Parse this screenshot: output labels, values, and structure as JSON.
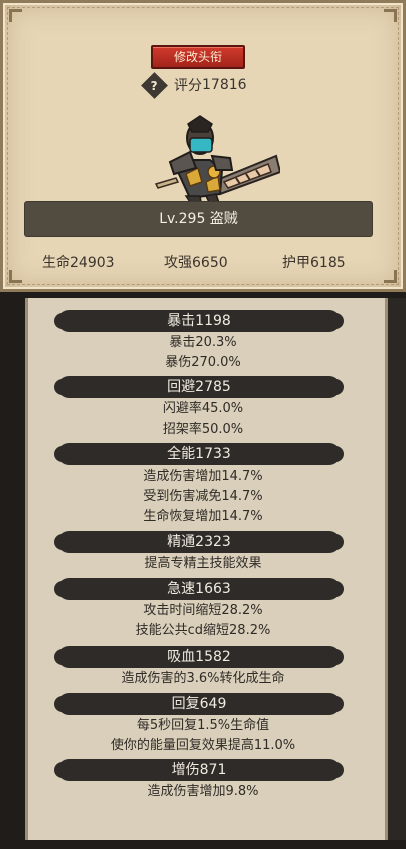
{
  "header": {
    "rename_button": "修改头衔",
    "score_label": "评分",
    "score_value": "17816",
    "name": "Lv.295 盗贼"
  },
  "base_stats": {
    "hp": "生命24903",
    "attack": "攻强6650",
    "armor": "护甲6185"
  },
  "stats": {
    "crit": {
      "title": "暴击1198",
      "lines": [
        "暴击20.3%",
        "暴伤270.0%"
      ]
    },
    "dodge": {
      "title": "回避2785",
      "lines": [
        "闪避率45.0%",
        "招架率50.0%"
      ]
    },
    "versatility": {
      "title": "全能1733",
      "lines": [
        "造成伤害增加14.7%",
        "受到伤害减免14.7%",
        "生命恢复增加14.7%"
      ]
    },
    "mastery": {
      "title": "精通2323",
      "lines": [
        "提高专精主技能效果"
      ]
    },
    "haste": {
      "title": "急速1663",
      "lines": [
        "攻击时间缩短28.2%",
        "技能公共cd缩短28.2%"
      ]
    },
    "leech": {
      "title": "吸血1582",
      "lines": [
        "造成伤害的3.6%转化成生命"
      ]
    },
    "regen": {
      "title": "回复649",
      "lines": [
        "每5秒回复1.5%生命值",
        "使你的能量回复效果提高11.0%"
      ]
    },
    "damage_boost": {
      "title": "增伤871",
      "lines": [
        "造成伤害增加9.8%"
      ]
    }
  },
  "colors": {
    "parchment": "#e6d6b6",
    "rename_button": "#c2302a",
    "bar_dark": "#2f2b28",
    "panel_bg": "#d9cfba"
  }
}
